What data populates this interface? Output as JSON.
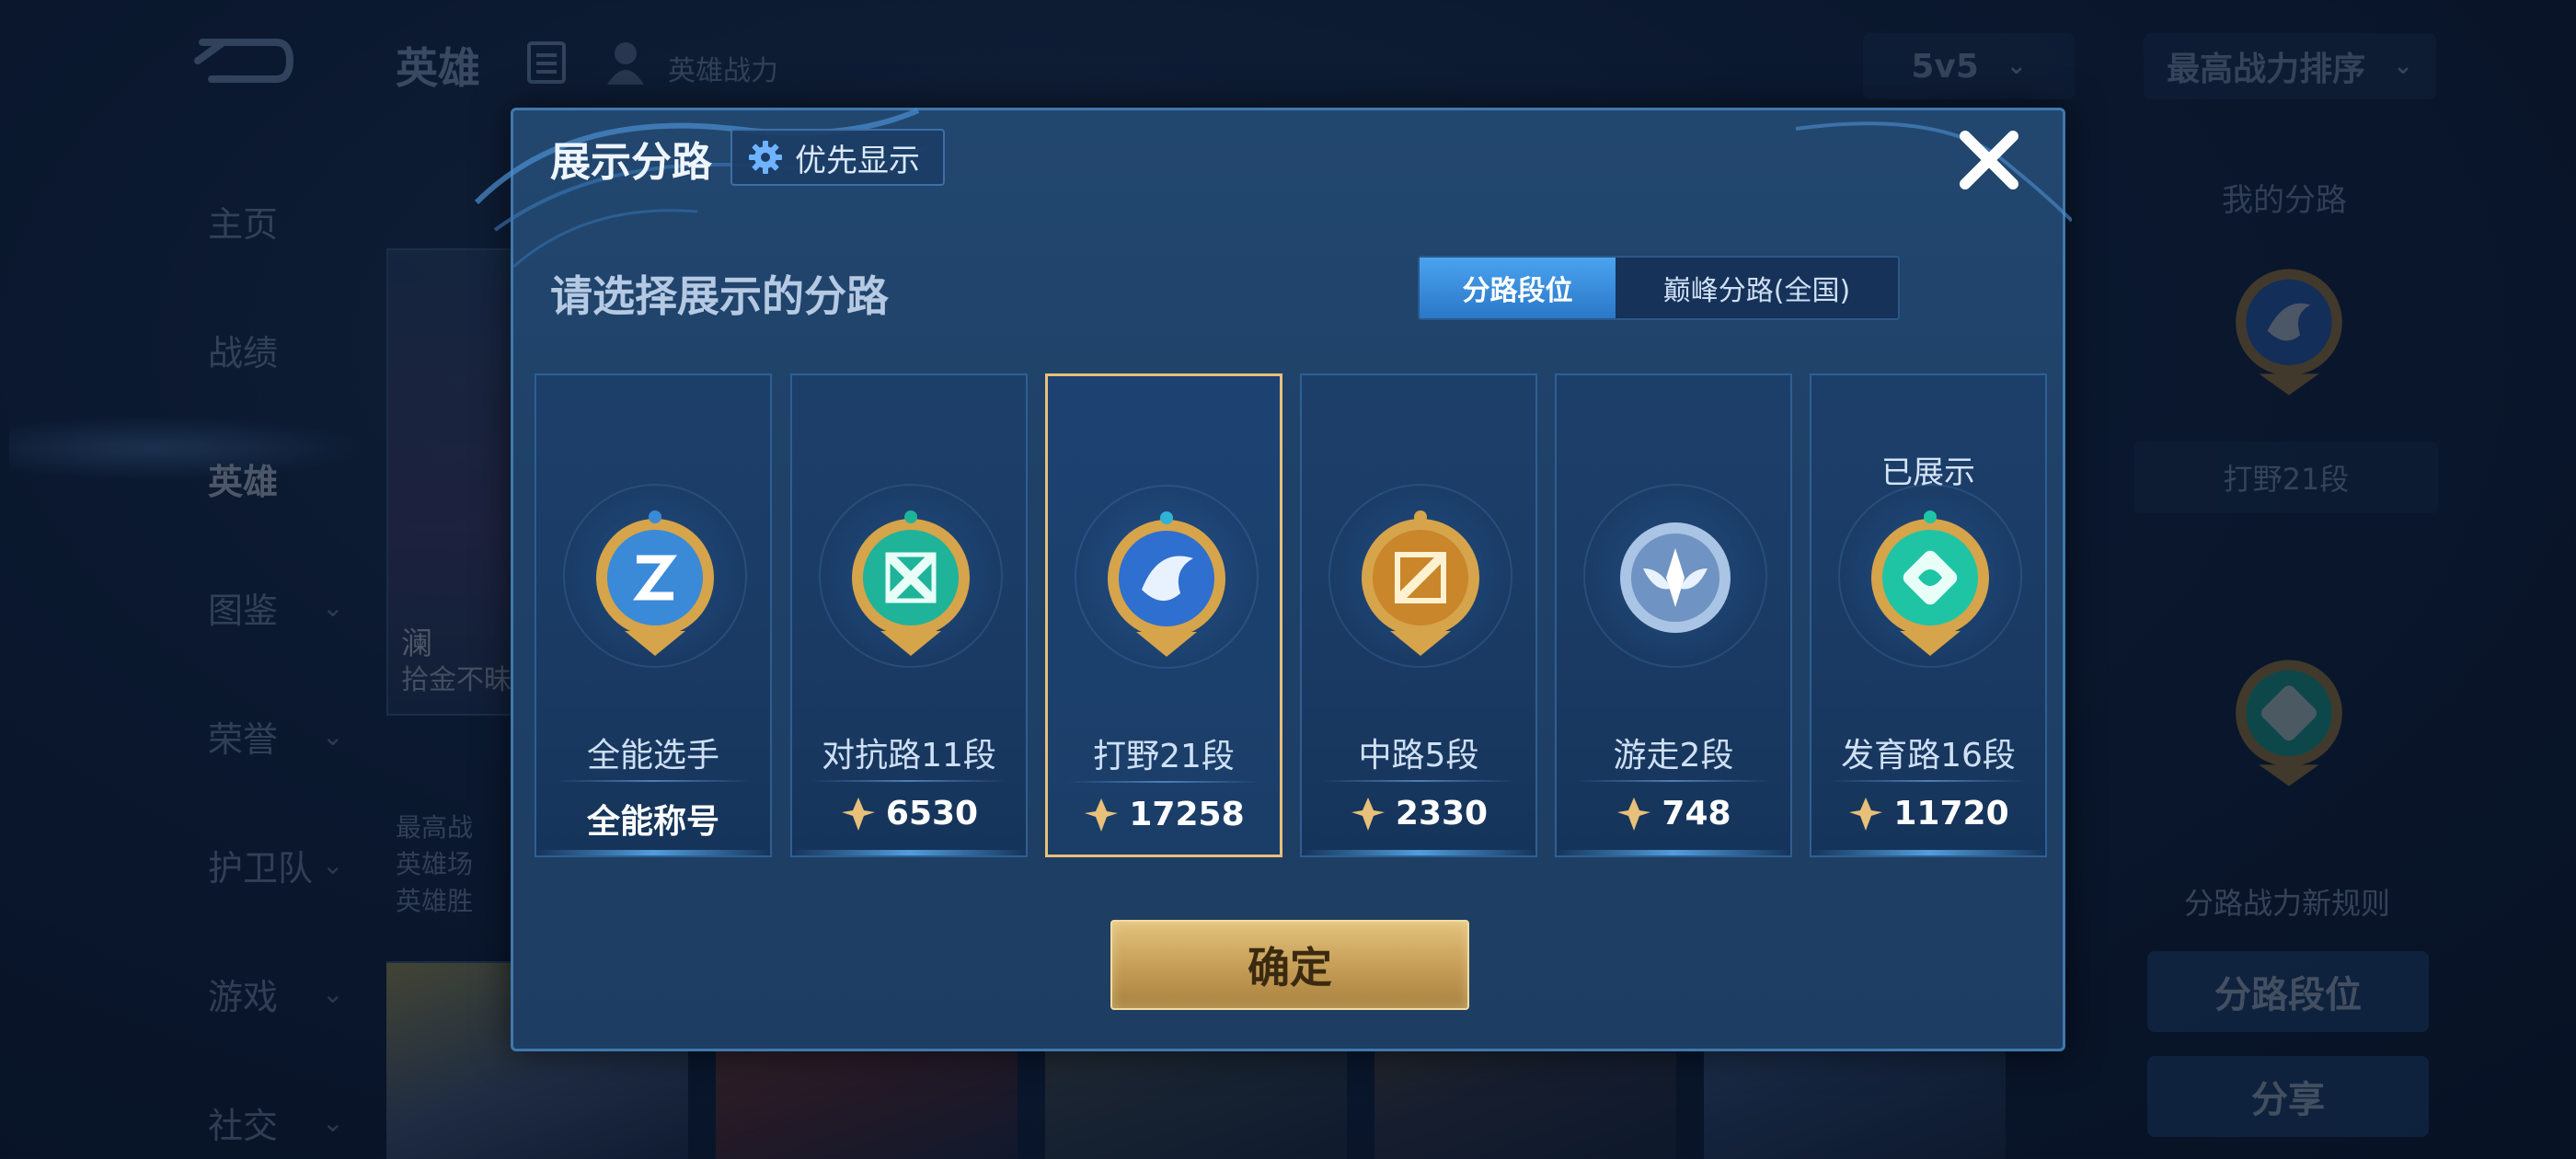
{
  "background": {
    "page_title": "英雄",
    "sub_title": "英雄战力",
    "mode_select": "5v5",
    "sort_select": "最高战力排序",
    "sidebar": [
      {
        "label": "主页"
      },
      {
        "label": "战绩"
      },
      {
        "label": "英雄",
        "active": true
      },
      {
        "label": "图鉴"
      },
      {
        "label": "荣誉"
      },
      {
        "label": "护卫队"
      },
      {
        "label": "游戏"
      },
      {
        "label": "社交"
      }
    ],
    "hero_card": {
      "name": "澜",
      "title": "拾金不昧"
    },
    "hero_stats": [
      "最高战",
      "英雄场",
      "英雄胜"
    ],
    "right_panel": {
      "title": "我的分路",
      "label": "打野21段",
      "rule_text": "分路战力新规则",
      "btn_lane_rank": "分路段位",
      "btn_share": "分享"
    }
  },
  "modal": {
    "title": "展示分路",
    "priority_button": "优先显示",
    "subtitle": "请选择展示的分路",
    "toggle": {
      "active": "分路段位",
      "inactive": "巅峰分路(全国)"
    },
    "cards": [
      {
        "lane": "全能选手",
        "value": "全能称号",
        "shown_label": "",
        "badge_color": "#3a8ad8",
        "selected": false
      },
      {
        "lane": "对抗路11段",
        "value": "6530",
        "shown_label": "",
        "badge_color": "#1fb39a",
        "selected": false
      },
      {
        "lane": "打野21段",
        "value": "17258",
        "shown_label": "",
        "badge_color": "#2f6fcf",
        "selected": true
      },
      {
        "lane": "中路5段",
        "value": "2330",
        "shown_label": "",
        "badge_color": "#d59a2e",
        "selected": false
      },
      {
        "lane": "游走2段",
        "value": "748",
        "shown_label": "",
        "badge_color": "#7ea8d8",
        "selected": false
      },
      {
        "lane": "发育路16段",
        "value": "11720",
        "shown_label": "已展示",
        "badge_color": "#1fc4a4",
        "selected": false
      }
    ],
    "confirm_button": "确定"
  },
  "colors": {
    "accent_gold": "#e8c07a",
    "modal_bg": "#22476f",
    "toggle_active": "#2a78c8"
  }
}
